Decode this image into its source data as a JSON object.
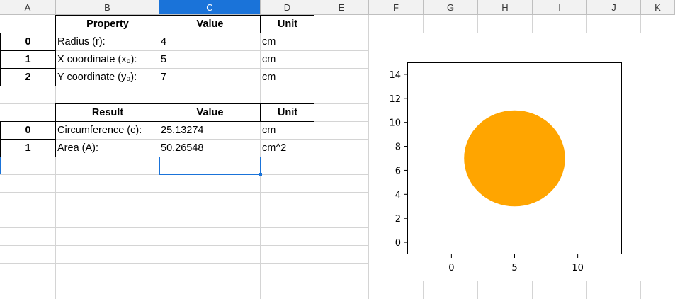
{
  "columns": [
    "A",
    "B",
    "C",
    "D",
    "E",
    "F",
    "G",
    "H",
    "I",
    "J",
    "K"
  ],
  "active_column": "C",
  "table1": {
    "headers": [
      "Property",
      "Value",
      "Unit"
    ],
    "rows": [
      {
        "index": "0",
        "property": "Radius (r):",
        "value": "4",
        "unit": "cm"
      },
      {
        "index": "1",
        "property": "X coordinate (x₀):",
        "value": "5",
        "unit": "cm"
      },
      {
        "index": "2",
        "property": "Y coordinate (y₀):",
        "value": "7",
        "unit": "cm"
      }
    ]
  },
  "table2": {
    "headers": [
      "Result",
      "Value",
      "Unit"
    ],
    "rows": [
      {
        "index": "0",
        "property": "Circumference (c):",
        "value": "25.13274",
        "unit": "cm"
      },
      {
        "index": "1",
        "property": "Area (A):",
        "value": "50.26548",
        "unit": "cm^2"
      }
    ]
  },
  "chart_data": {
    "type": "scatter",
    "shape": "circle",
    "center": [
      5,
      7
    ],
    "radius": 4,
    "fill_color": "#ffa500",
    "xlim": [
      -3.5,
      13.5
    ],
    "ylim": [
      -1,
      15
    ],
    "xticks": [
      0,
      5,
      10
    ],
    "yticks": [
      0,
      2,
      4,
      6,
      8,
      10,
      12,
      14
    ],
    "grid": false
  }
}
